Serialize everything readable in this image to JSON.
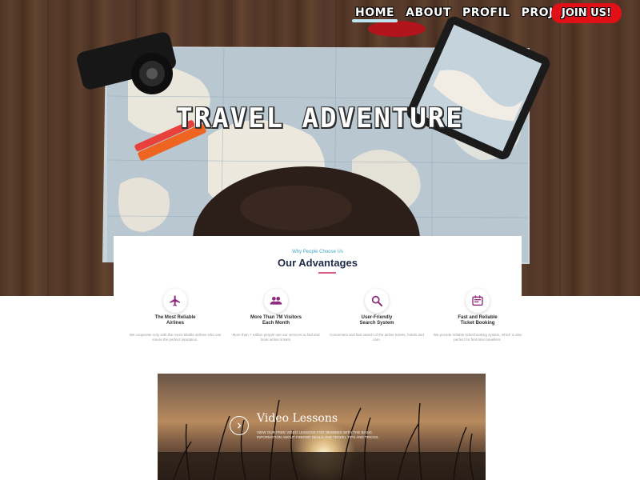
{
  "nav": {
    "items": [
      {
        "label": "HOME",
        "active": true
      },
      {
        "label": "ABOUT",
        "active": false
      },
      {
        "label": "PROFIL",
        "active": false
      },
      {
        "label": "PROJECT",
        "active": false
      }
    ],
    "join_label": "JOIN US!"
  },
  "hero": {
    "title": "TRAVEL ADVENTURE"
  },
  "advantages": {
    "eyebrow": "Why People Choose Us",
    "title": "Our Advantages",
    "items": [
      {
        "icon": "airplane-icon",
        "name_line1": "The Most Reliable",
        "name_line2": "Airlines",
        "desc": "We cooperate only with the most reliable airlines who can insure the perfect reputation."
      },
      {
        "icon": "users-icon",
        "name_line1": "More Than 7M Visitors",
        "name_line2": "Each Month",
        "desc": "More than 7 million people use our services to find and book airline tickets."
      },
      {
        "icon": "search-icon",
        "name_line1": "User-Friendly",
        "name_line2": "Search System",
        "desc": "Convenient and fast search of the airline tickets, hotels and cars."
      },
      {
        "icon": "ticket-icon",
        "name_line1": "Fast and Reliable",
        "name_line2": "Ticket Booking",
        "desc": "We provide reliable ticket booking system, which is also perfect for first-time travellers."
      }
    ]
  },
  "video": {
    "title": "Video Lessons",
    "desc": "View our free video lessons for newbies with the basic information about finding deals and travel tips and tricks."
  },
  "colors": {
    "accent_red": "#e10f16",
    "brand_purple": "#8e2a7d",
    "link_blue": "#3fa6c4",
    "heading_navy": "#1f2a4a",
    "underline_pink": "#d65a86"
  }
}
